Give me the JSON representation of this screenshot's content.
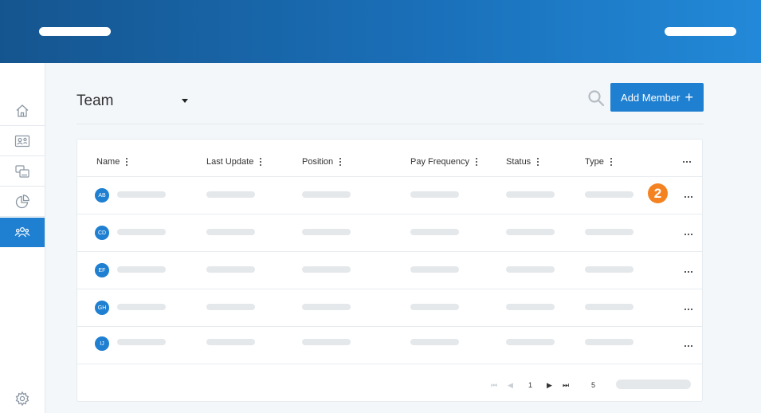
{
  "header": {
    "left_placeholder": "",
    "right_placeholder": ""
  },
  "sidebar": {
    "items": [
      {
        "icon": "home-icon"
      },
      {
        "icon": "id-card-icon"
      },
      {
        "icon": "devices-icon"
      },
      {
        "icon": "pie-chart-icon"
      },
      {
        "icon": "team-icon",
        "active": true
      }
    ],
    "settings_icon": "gear-icon"
  },
  "page": {
    "title": "Team",
    "add_button_label": "Add Member",
    "add_button_symbol": "+"
  },
  "table": {
    "columns": [
      "Name",
      "Last Update",
      "Position",
      "Pay Frequency",
      "Status",
      "Type"
    ],
    "rows": [
      {
        "initials": "AB"
      },
      {
        "initials": "CD"
      },
      {
        "initials": "EF"
      },
      {
        "initials": "GH"
      },
      {
        "initials": "IJ"
      }
    ],
    "step_badge": "2"
  },
  "pagination": {
    "first": "⏮",
    "prev": "◀",
    "page": "1",
    "next": "▶",
    "last": "⏭",
    "page_size": "5"
  },
  "colors": {
    "accent": "#1f7fd1",
    "badge": "#f58220",
    "header_dark": "#15558f",
    "header_light": "#2289d8"
  }
}
